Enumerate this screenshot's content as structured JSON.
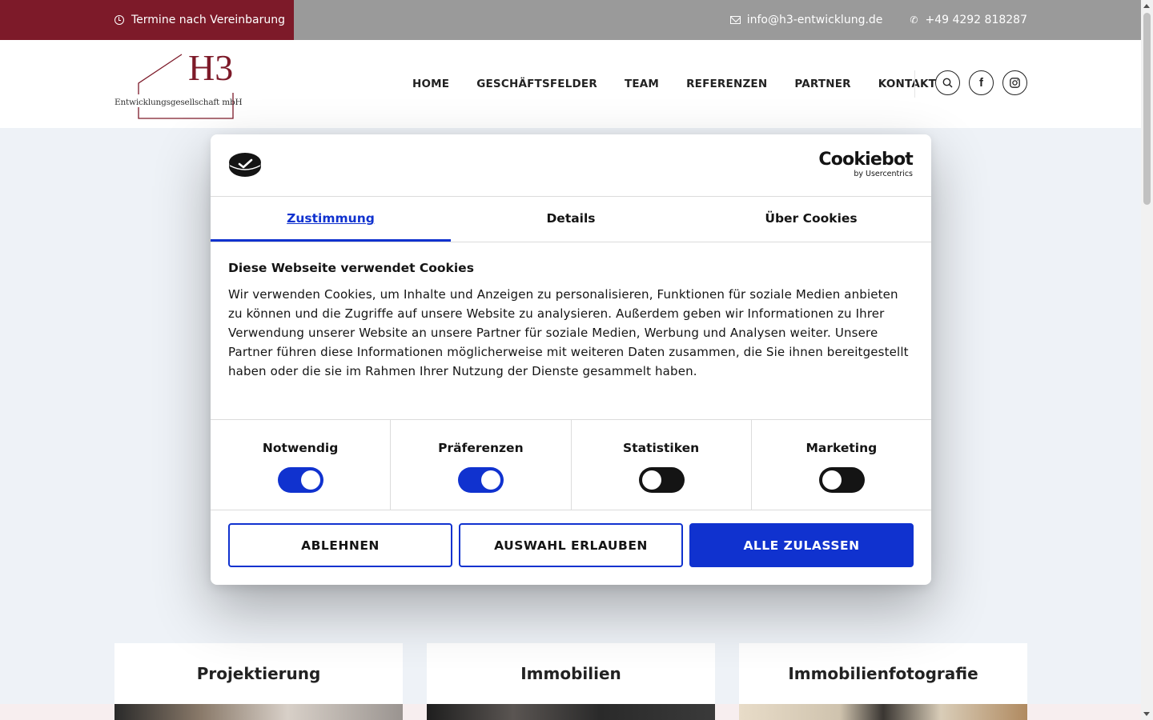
{
  "topbar": {
    "hours": "Termine nach Vereinbarung",
    "email": "info@h3-entwicklung.de",
    "phone": "+49 4292 818287"
  },
  "header": {
    "logo_mark": "H3",
    "logo_subtitle": "Entwicklungsgesellschaft mbH",
    "nav": [
      "HOME",
      "GESCHÄFTSFELDER",
      "TEAM",
      "REFERENZEN",
      "PARTNER",
      "KONTAKT"
    ],
    "icons": [
      "search-icon",
      "facebook-icon",
      "instagram-icon"
    ]
  },
  "cards": [
    "Projektierung",
    "Immobilien",
    "Immobilienfotografie"
  ],
  "cookie_dialog": {
    "brand": "Cookiebot",
    "brand_sub": "by Usercentrics",
    "tabs": [
      "Zustimmung",
      "Details",
      "Über Cookies"
    ],
    "active_tab": 0,
    "title": "Diese Webseite verwendet Cookies",
    "text": "Wir verwenden Cookies, um Inhalte und Anzeigen zu personalisieren, Funktionen für soziale Medien anbieten zu können und die Zugriffe auf unsere Website zu analysieren. Außerdem geben wir Informationen zu Ihrer Verwendung unserer Website an unsere Partner für soziale Medien, Werbung und Analysen weiter. Unsere Partner führen diese Informationen möglicherweise mit weiteren Daten zusammen, die Sie ihnen bereitgestellt haben oder die sie im Rahmen Ihrer Nutzung der Dienste gesammelt haben.",
    "categories": [
      {
        "label": "Notwendig",
        "enabled": true
      },
      {
        "label": "Präferenzen",
        "enabled": true
      },
      {
        "label": "Statistiken",
        "enabled": false
      },
      {
        "label": "Marketing",
        "enabled": false
      }
    ],
    "buttons": {
      "reject": "ABLEHNEN",
      "allow_selection": "AUSWAHL ERLAUBEN",
      "allow_all": "ALLE ZULASSEN"
    }
  },
  "colors": {
    "brand_red": "#7d1a29",
    "topbar_gray": "#9a9a9a",
    "cookiebot_blue": "#1032cf"
  }
}
